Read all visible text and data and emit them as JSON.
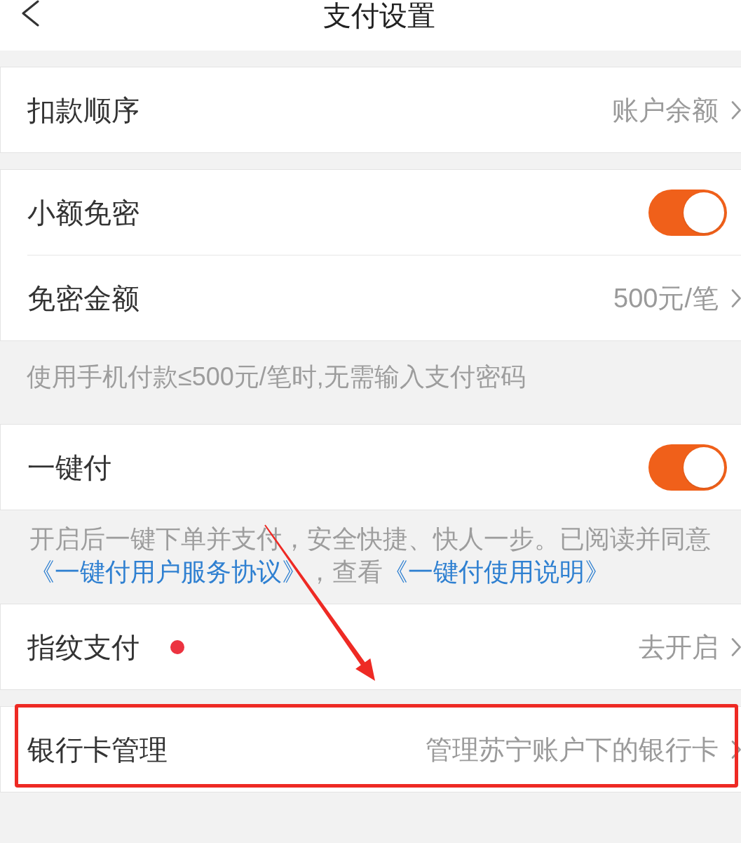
{
  "header": {
    "title": "支付设置"
  },
  "groups": [
    {
      "rows": [
        {
          "kind": "link",
          "label": "扣款顺序",
          "value": "账户余额"
        }
      ]
    },
    {
      "rows": [
        {
          "kind": "toggle",
          "label": "小额免密",
          "on": true
        },
        {
          "kind": "link",
          "label": "免密金额",
          "value": "500元/笔"
        }
      ],
      "note": [
        {
          "kind": "text",
          "text": "使用手机付款≤500元/笔时,无需输入支付密码"
        }
      ]
    },
    {
      "rows": [
        {
          "kind": "toggle",
          "label": "一键付",
          "on": true
        }
      ],
      "note": [
        {
          "kind": "text",
          "text": "开启后一键下单并支付，安全快捷、快人一步。已阅读并同意"
        },
        {
          "kind": "link",
          "text": "《一键付用户服务协议》"
        },
        {
          "kind": "text",
          "text": "，查看"
        },
        {
          "kind": "link",
          "text": "《一键付使用说明》"
        }
      ]
    },
    {
      "rows": [
        {
          "kind": "link",
          "label": "指纹支付",
          "badge_dot": true,
          "value": "去开启"
        }
      ]
    },
    {
      "highlighted": true,
      "rows": [
        {
          "kind": "link",
          "label": "银行卡管理",
          "value": "管理苏宁账户下的银行卡"
        }
      ]
    }
  ]
}
